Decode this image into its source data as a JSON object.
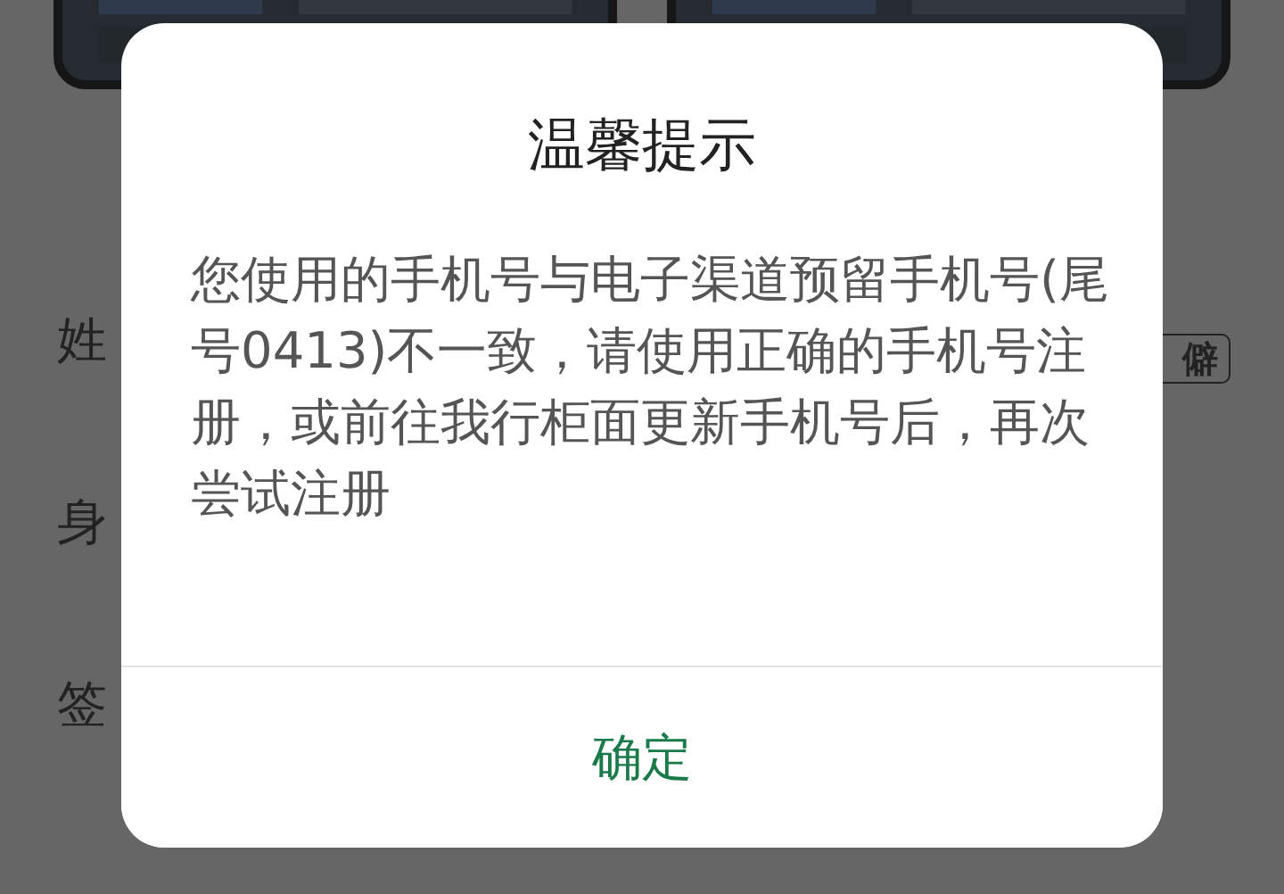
{
  "background": {
    "fields": [
      {
        "label": "姓"
      },
      {
        "label": "身"
      },
      {
        "label": "签"
      }
    ],
    "rare_char_badge": "僻"
  },
  "dialog": {
    "title": "温馨提示",
    "message": "您使用的手机号与电子渠道预留手机号(尾号0413)不一致，请使用正确的手机号注册，或前往我行柜面更新手机号后，再次尝试注册",
    "button": "确定"
  }
}
